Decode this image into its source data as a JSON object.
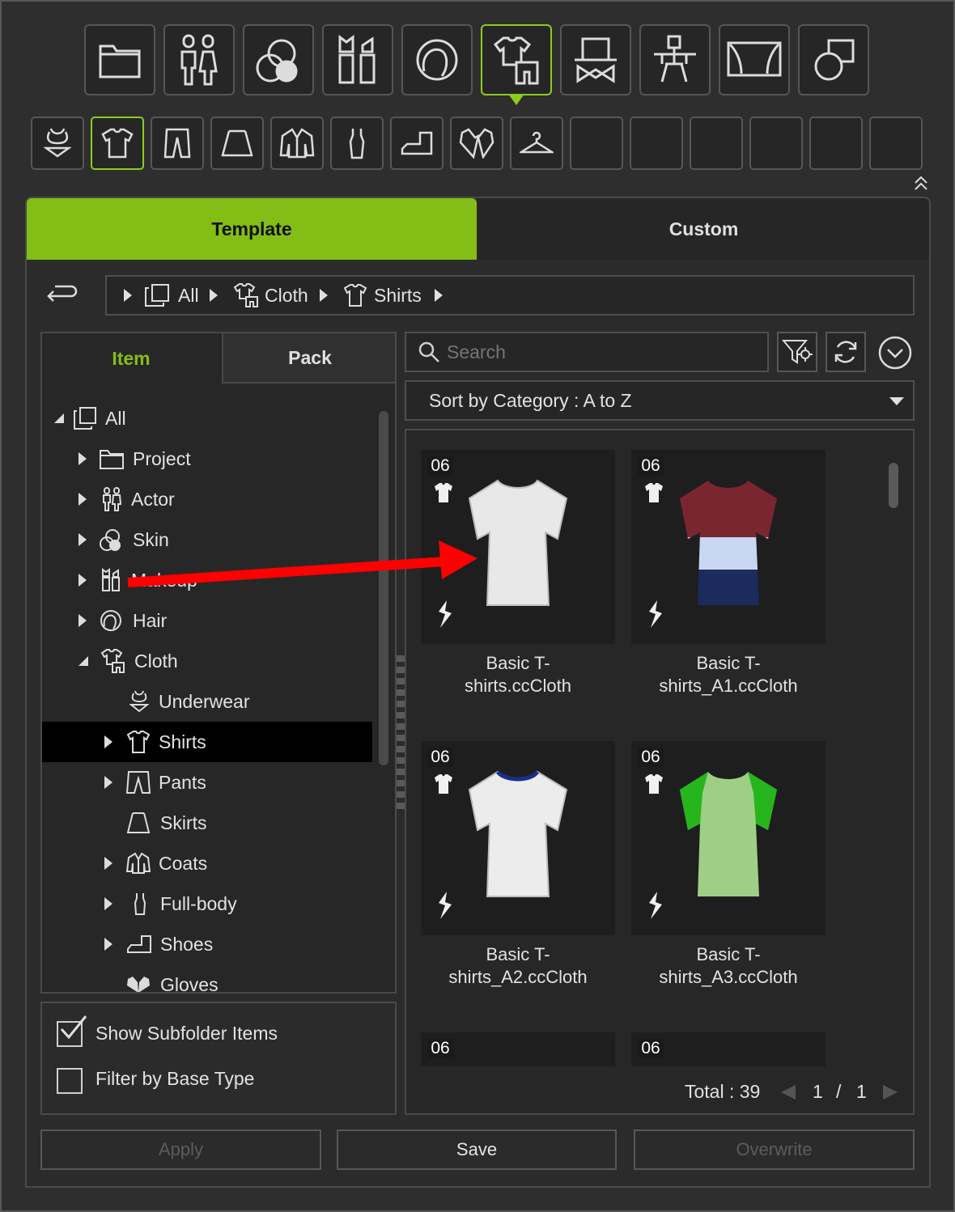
{
  "toolbar": {
    "main_icons": [
      "project-icon",
      "actor-icon",
      "skin-icon",
      "makeup-icon",
      "hair-icon",
      "cloth-icon",
      "accessory-icon",
      "prop-icon",
      "stage-icon",
      "layers-icon"
    ],
    "selected_main": "cloth-icon",
    "sub_icons": [
      "underwear-icon",
      "shirt-icon",
      "pants-icon",
      "skirt-icon",
      "coat-icon",
      "full-body-icon",
      "shoes-icon",
      "gloves-icon",
      "hanger-icon"
    ],
    "selected_sub": "shirt-icon"
  },
  "tabs": {
    "template": "Template",
    "custom": "Custom"
  },
  "breadcrumb": {
    "all": "All",
    "cloth": "Cloth",
    "shirts": "Shirts"
  },
  "left_tabs": {
    "item": "Item",
    "pack": "Pack"
  },
  "tree": {
    "all": "All",
    "project": "Project",
    "actor": "Actor",
    "skin": "Skin",
    "makeup": "Makeup",
    "hair": "Hair",
    "cloth": "Cloth",
    "underwear": "Underwear",
    "shirts": "Shirts",
    "pants": "Pants",
    "skirts": "Skirts",
    "coats": "Coats",
    "fullbody": "Full-body",
    "shoes": "Shoes",
    "gloves": "Gloves"
  },
  "search": {
    "placeholder": "Search"
  },
  "sort": {
    "label": "Sort by Category : A to Z"
  },
  "items": [
    {
      "badge": "06",
      "line1": "Basic T-",
      "line2": "shirts.ccCloth",
      "color": "#e8e8e8"
    },
    {
      "badge": "06",
      "line1": "Basic T-",
      "line2": "shirts_A1.ccCloth",
      "color": "#7a2630"
    },
    {
      "badge": "06",
      "line1": "Basic T-",
      "line2": "shirts_A2.ccCloth",
      "color": "#ececec"
    },
    {
      "badge": "06",
      "line1": "Basic T-",
      "line2": "shirts_A3.ccCloth",
      "color": "#9fcf86"
    },
    {
      "badge": "06"
    },
    {
      "badge": "06"
    }
  ],
  "options": {
    "show_subfolder": "Show Subfolder Items",
    "filter_base": "Filter by Base Type"
  },
  "pager": {
    "total": "Total : 39",
    "page": "1",
    "sep": "/",
    "pages": "1"
  },
  "buttons": {
    "apply": "Apply",
    "save": "Save",
    "overwrite": "Overwrite"
  },
  "colors": {
    "accent": "#84bd16",
    "annotation_arrow": "#ff0000"
  }
}
